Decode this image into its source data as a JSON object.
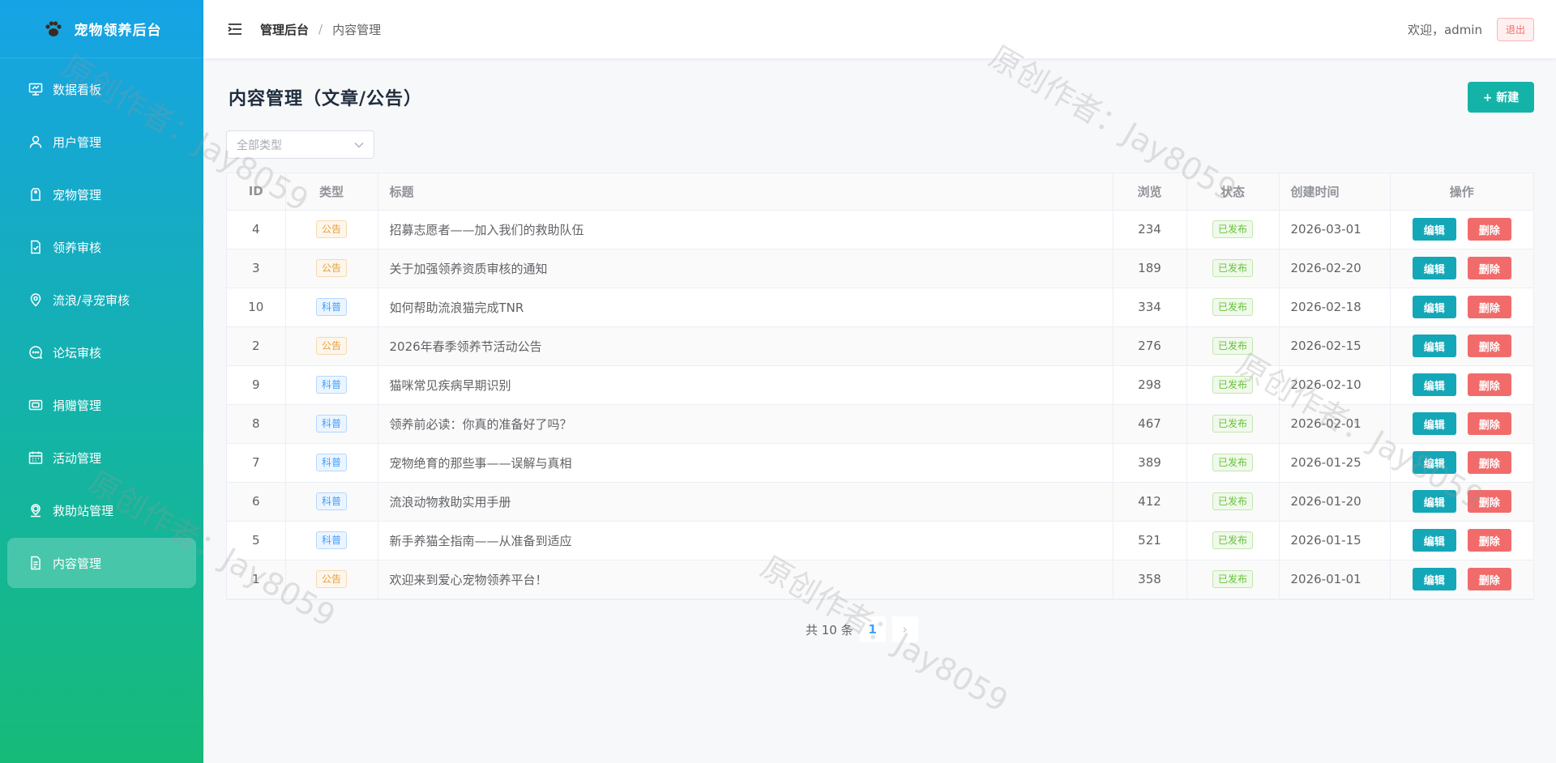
{
  "app": {
    "title": "宠物领养后台"
  },
  "sidebar": {
    "items": [
      {
        "label": "数据看板",
        "icon": "dashboard-icon"
      },
      {
        "label": "用户管理",
        "icon": "user-icon"
      },
      {
        "label": "宠物管理",
        "icon": "tag-icon"
      },
      {
        "label": "领养审核",
        "icon": "document-check-icon"
      },
      {
        "label": "流浪/寻宠审核",
        "icon": "location-icon"
      },
      {
        "label": "论坛审核",
        "icon": "chat-icon"
      },
      {
        "label": "捐赠管理",
        "icon": "wallet-icon"
      },
      {
        "label": "活动管理",
        "icon": "calendar-icon"
      },
      {
        "label": "救助站管理",
        "icon": "place-icon"
      },
      {
        "label": "内容管理",
        "icon": "document-icon",
        "active": true
      }
    ]
  },
  "header": {
    "breadcrumb_root": "管理后台",
    "breadcrumb_sep": "/",
    "breadcrumb_current": "内容管理",
    "welcome": "欢迎，admin",
    "logout": "退出"
  },
  "main": {
    "title": "内容管理（文章/公告）",
    "new_button": "+ 新建",
    "type_select": {
      "placeholder": "全部类型"
    }
  },
  "table": {
    "columns": [
      "ID",
      "类型",
      "标题",
      "浏览",
      "状态",
      "创建时间",
      "操作"
    ],
    "edit_label": "编辑",
    "delete_label": "删除",
    "rows": [
      {
        "id": "4",
        "type": "公告",
        "type_kind": "notice",
        "title": "招募志愿者——加入我们的救助队伍",
        "views": "234",
        "status": "已发布",
        "created": "2026-03-01"
      },
      {
        "id": "3",
        "type": "公告",
        "type_kind": "notice",
        "title": "关于加强领养资质审核的通知",
        "views": "189",
        "status": "已发布",
        "created": "2026-02-20"
      },
      {
        "id": "10",
        "type": "科普",
        "type_kind": "sci",
        "title": "如何帮助流浪猫完成TNR",
        "views": "334",
        "status": "已发布",
        "created": "2026-02-18"
      },
      {
        "id": "2",
        "type": "公告",
        "type_kind": "notice",
        "title": "2026年春季领养节活动公告",
        "views": "276",
        "status": "已发布",
        "created": "2026-02-15"
      },
      {
        "id": "9",
        "type": "科普",
        "type_kind": "sci",
        "title": "猫咪常见疾病早期识别",
        "views": "298",
        "status": "已发布",
        "created": "2026-02-10"
      },
      {
        "id": "8",
        "type": "科普",
        "type_kind": "sci",
        "title": "领养前必读：你真的准备好了吗？",
        "views": "467",
        "status": "已发布",
        "created": "2026-02-01"
      },
      {
        "id": "7",
        "type": "科普",
        "type_kind": "sci",
        "title": "宠物绝育的那些事——误解与真相",
        "views": "389",
        "status": "已发布",
        "created": "2026-01-25"
      },
      {
        "id": "6",
        "type": "科普",
        "type_kind": "sci",
        "title": "流浪动物救助实用手册",
        "views": "412",
        "status": "已发布",
        "created": "2026-01-20"
      },
      {
        "id": "5",
        "type": "科普",
        "type_kind": "sci",
        "title": "新手养猫全指南——从准备到适应",
        "views": "521",
        "status": "已发布",
        "created": "2026-01-15"
      },
      {
        "id": "1",
        "type": "公告",
        "type_kind": "notice",
        "title": "欢迎来到爱心宠物领养平台！",
        "views": "358",
        "status": "已发布",
        "created": "2026-01-01"
      }
    ]
  },
  "pagination": {
    "total_text": "共 10 条",
    "current_page": "1",
    "next_symbol": "›"
  },
  "watermark": "原创作者：Jay8059",
  "colors": {
    "accent": "#14b3a8",
    "edit": "#14a7b8",
    "delete": "#f26b6b",
    "notice": "#e6a23c",
    "sci": "#409eff",
    "published": "#67c23a"
  }
}
